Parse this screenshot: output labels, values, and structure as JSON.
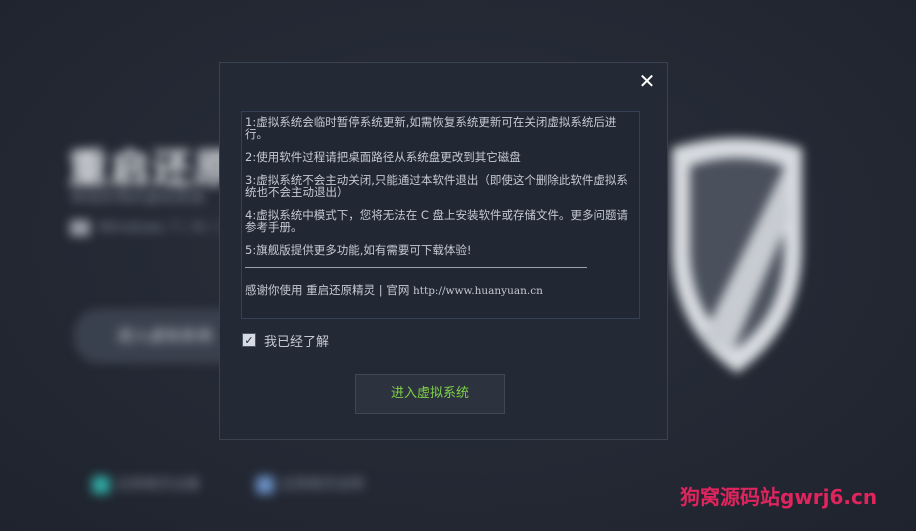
{
  "background": {
    "title": "重启还原",
    "subtitle": "体验好用的虚拟系统",
    "windows_label": "Windows 7 / 8 / 10",
    "main_button": "进入虚拟系统",
    "footer_left": "还原精灵设置",
    "footer_right": "还原精灵说明"
  },
  "dialog": {
    "close_label": "✕",
    "notices": [
      "1:虚拟系统会临时暂停系统更新,如需恢复系统更新可在关闭虚拟系统后进行。",
      "2:使用软件过程请把桌面路径从系统盘更改到其它磁盘",
      "3:虚拟系统不会主动关闭,只能通过本软件退出（即使这个删除此软件虚拟系统也不会主动退出）",
      "4:虚拟系统中模式下，您将无法在 C 盘上安装软件或存储文件。更多问题请参考手册。",
      "5:旗舰版提供更多功能,如有需要可下载体验!"
    ],
    "thanks_prefix": "感谢你使用 重启还原精灵 | 官网",
    "thanks_url": "http://www.huanyuan.cn",
    "checkbox_label": "我已经了解",
    "checkbox_checked": true,
    "enter_button": "进入虚拟系统"
  },
  "watermark": "狗窝源码站gwrj6.cn",
  "colors": {
    "accent_green": "#7fd04a",
    "watermark": "#e0245e"
  }
}
